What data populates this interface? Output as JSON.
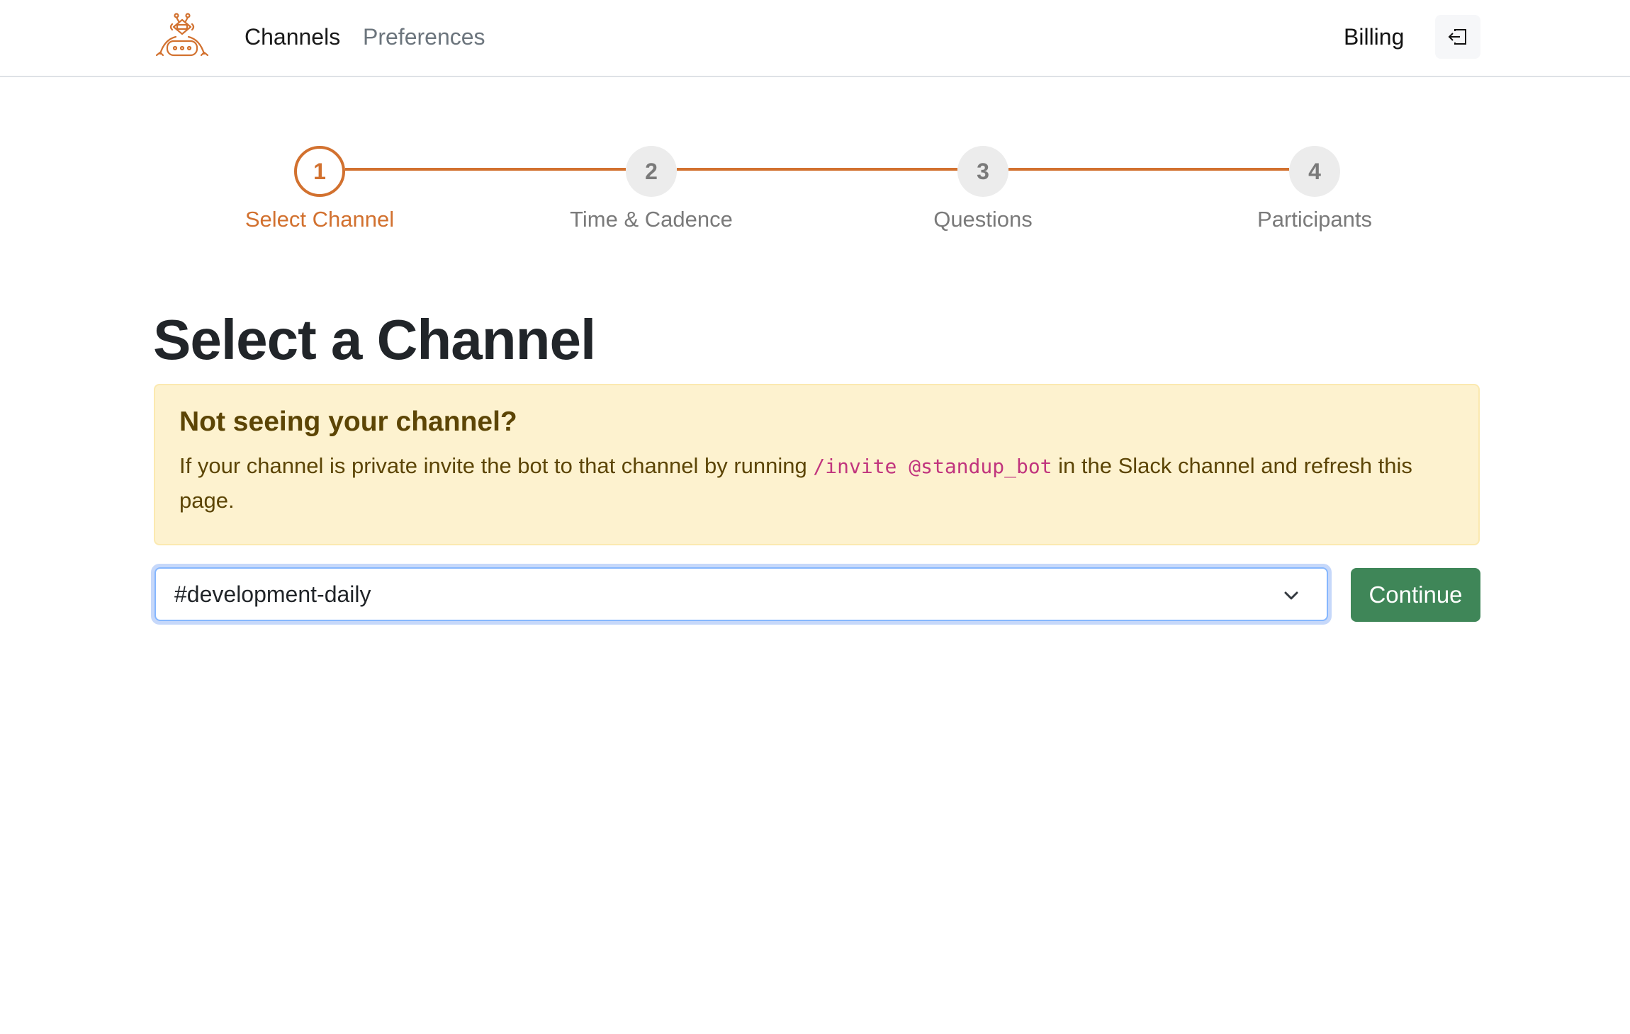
{
  "header": {
    "logo_icon": "robot-icon",
    "nav": [
      {
        "label": "Channels",
        "active": true
      },
      {
        "label": "Preferences",
        "active": false
      }
    ],
    "billing_label": "Billing",
    "logout_icon": "logout-icon"
  },
  "stepper": {
    "current_step": 1,
    "steps": [
      {
        "number": "1",
        "label": "Select Channel"
      },
      {
        "number": "2",
        "label": "Time & Cadence"
      },
      {
        "number": "3",
        "label": "Questions"
      },
      {
        "number": "4",
        "label": "Participants"
      }
    ]
  },
  "main": {
    "title": "Select a Channel",
    "alert": {
      "heading": "Not seeing your channel?",
      "text_before": "If your channel is private invite the bot to that channel by running ",
      "code": "/invite @standup_bot",
      "text_after": " in the Slack channel and refresh this page."
    },
    "channel_select": {
      "value": "#development-daily"
    },
    "continue_label": "Continue"
  },
  "colors": {
    "accent": "#d2712f",
    "success": "#3f8658",
    "alert_bg": "#fdf2cf",
    "code": "#c1357e"
  }
}
